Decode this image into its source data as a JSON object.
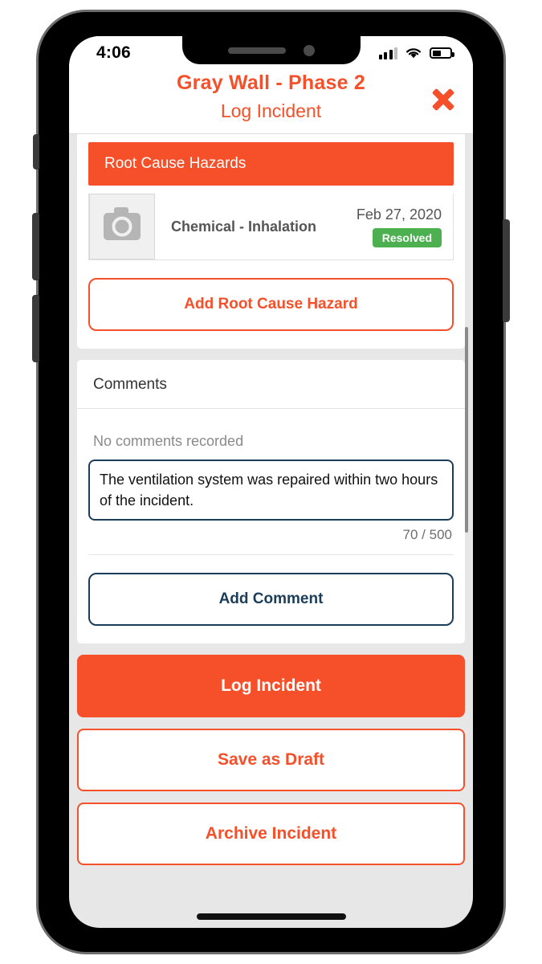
{
  "status_bar": {
    "time": "4:06",
    "signal_icon": "cellular-signal-icon",
    "signal_bars_filled": 3,
    "signal_bars_total": 4,
    "wifi_icon": "wifi-icon",
    "battery_icon": "battery-icon",
    "battery_percent": 45
  },
  "header": {
    "project_title": "Gray Wall - Phase 2",
    "screen_title": "Log Incident",
    "close_icon": "close-x-icon"
  },
  "hazards_card": {
    "section_header": "Root Cause Hazards",
    "rows": [
      {
        "thumbnail_icon": "camera-placeholder-icon",
        "name": "Chemical - Inhalation",
        "date": "Feb 27, 2020",
        "status": "Resolved",
        "status_color": "#4caf50"
      }
    ],
    "add_button_label": "Add Root Cause Hazard"
  },
  "comments_card": {
    "title": "Comments",
    "empty_note": "No comments recorded",
    "input_value": "The ventilation system was repaired within two hours of the incident.",
    "input_placeholder": "",
    "char_counter": "70 / 500",
    "add_button_label": "Add Comment"
  },
  "actions": {
    "log_incident": "Log Incident",
    "save_draft": "Save as Draft",
    "archive_incident": "Archive Incident"
  },
  "colors": {
    "accent_orange": "#f5502a",
    "navy": "#1c3d5a",
    "status_green": "#4caf50",
    "page_bg": "#e7e7e7"
  }
}
